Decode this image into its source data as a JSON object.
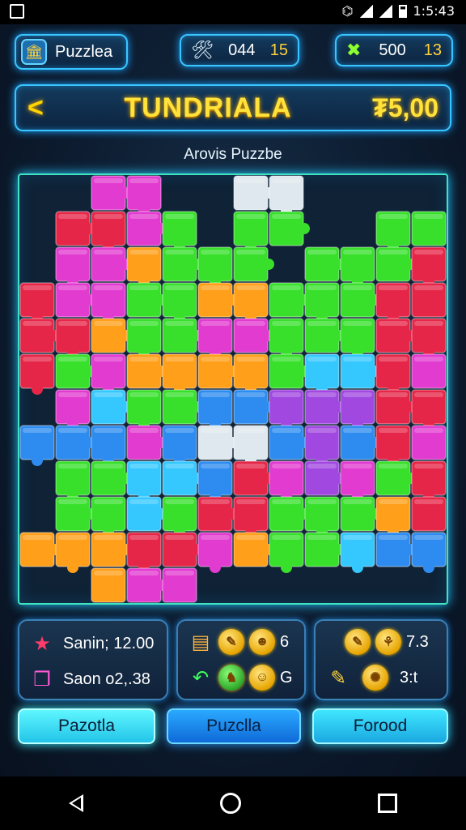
{
  "status_bar": {
    "time": "1:5:43"
  },
  "header": {
    "brand_label": "Puzzlea",
    "stat1": {
      "value": "044",
      "bonus": "15"
    },
    "stat2": {
      "value": "500",
      "bonus": "13"
    }
  },
  "title_bar": {
    "title": "TUNDRIALA",
    "price": "₮5,00"
  },
  "board": {
    "subtitle": "Arovis Puzzbe",
    "colors": {
      "G": "#38e02c",
      "P": "#e23bd0",
      "R": "#e62648",
      "O": "#ff9f1a",
      "B": "#2e8cf0",
      "C": "#35c8ff",
      "V": "#a048e0",
      "W": "#dfe8ee",
      "E": ""
    },
    "rows": [
      "EEPPEEWWEEEE",
      "ERRPGEGGEEGG",
      "EPPOGGGEGGGR",
      "RPPGGOOGGGRR",
      "RROGGPPGGGRR",
      "RGPOOOOGCCRP",
      "EPCGGBBVVVRR",
      "BBBPBWWBVBRP",
      "EGGCCBRPVPGR",
      "EGGCGRRGGGOR",
      "OOORRPOGGCBB",
      "EEOPPEEEEEEE"
    ]
  },
  "cards": {
    "left": {
      "line1": "Sanin; 12.00",
      "line2": "Saon o2,.38"
    },
    "middle": {
      "line1": "6",
      "line2": "G"
    },
    "right": {
      "line1": "7.3",
      "line2": "3:t"
    }
  },
  "buttons": {
    "left": "Pazotla",
    "middle": "Puzclla",
    "right": "Forood"
  }
}
